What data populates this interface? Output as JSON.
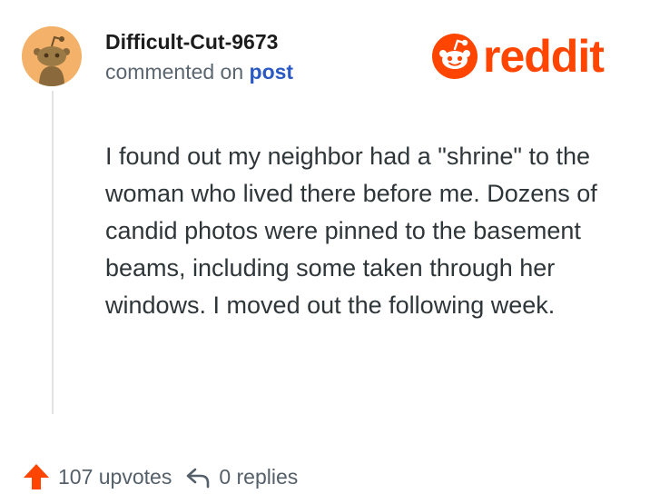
{
  "comment": {
    "username": "Difficult-Cut-9673",
    "action_text": "commented on",
    "post_link": "post",
    "body": "I found out my neighbor had a \"shrine\" to the woman who lived there before me. Dozens of candid photos were pinned to the basement beams, including some taken through her windows. I moved out the following week.",
    "upvotes_label": "107 upvotes",
    "replies_label": "0 replies"
  },
  "brand": {
    "logo_text": "reddit",
    "color": "#ff4500"
  },
  "avatar": {
    "background": "#f4b169",
    "icon": "snoo-avatar-icon"
  },
  "icons": {
    "upvote": "upvote-arrow-icon",
    "reply": "reply-arrow-icon",
    "logo": "reddit-logo-icon"
  }
}
